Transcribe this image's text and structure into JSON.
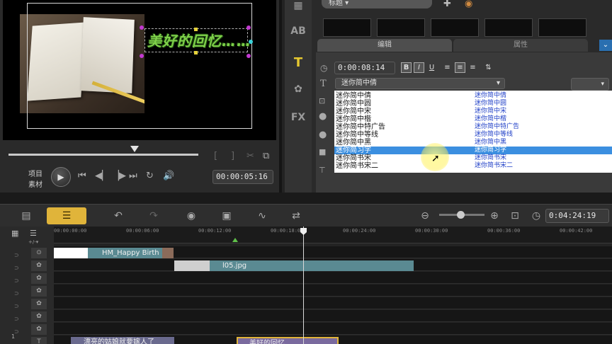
{
  "preview": {
    "overlay_title": "美好的回忆……",
    "mode_project": "项目",
    "mode_clip": "素材",
    "timecode": "00:00:05:16"
  },
  "library": {
    "category": "标题",
    "tabs": {
      "edit": "编辑",
      "attributes": "属性"
    },
    "duration": "0:00:08:14",
    "format": {
      "bold": "B",
      "italic": "I",
      "underline": "U"
    },
    "font_selected": "迷你简中倩",
    "fonts": [
      {
        "name": "迷你简中倩",
        "sample": "迷你简中倩"
      },
      {
        "name": "迷你简中圆",
        "sample": "迷你简中圆"
      },
      {
        "name": "迷你简中宋",
        "sample": "迷你简中宋"
      },
      {
        "name": "迷你简中楷",
        "sample": "迷你简中楷"
      },
      {
        "name": "迷你简中特广告",
        "sample": "迷你简中特广告"
      },
      {
        "name": "迷你简中等线",
        "sample": "迷你简中等线"
      },
      {
        "name": "迷你简中黑",
        "sample": "迷你简中黑"
      },
      {
        "name": "迷你简习字",
        "sample": "迷你简习字"
      },
      {
        "name": "迷你简书宋",
        "sample": "迷你简书宋"
      },
      {
        "name": "迷你简书宋二",
        "sample": "迷你简书宋二"
      }
    ],
    "selected_index": 7
  },
  "timeline": {
    "project_duration": "0:04:24:19",
    "ruler_ticks": [
      "00:00:00:00",
      "00:00:06:00",
      "00:00:12:00",
      "00:00:18:00",
      "00:00:24:00",
      "00:00:30:00",
      "00:00:36:00",
      "00:00:42:00"
    ],
    "clips": {
      "video_title": "HM_Happy Birth",
      "overlay_image": "l05.jpg",
      "title_1": "漂亮的姑娘就要嫁人了",
      "title_2": "美好的回忆……"
    }
  },
  "colors": {
    "accent": "#e0b43a",
    "selection": "#3b8fe0",
    "title_green": "#7fd04a",
    "clip_teal": "#5a8a92"
  }
}
